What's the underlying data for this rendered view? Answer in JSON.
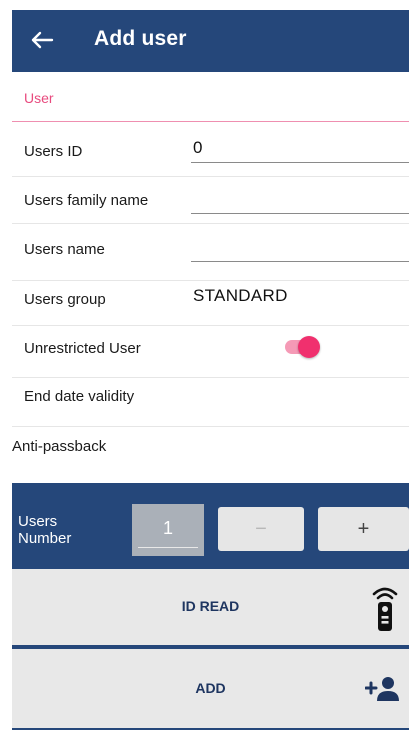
{
  "header": {
    "title": "Add user",
    "back_icon": "arrow-left-icon"
  },
  "section": {
    "label": "User"
  },
  "form": {
    "users_id": {
      "label": "Users ID",
      "value": "0"
    },
    "family_name": {
      "label": "Users family name",
      "value": ""
    },
    "name": {
      "label": "Users name",
      "value": ""
    },
    "group": {
      "label": "Users group",
      "value": "STANDARD"
    },
    "unrestricted": {
      "label": "Unrestricted User",
      "enabled": true
    },
    "end_date": {
      "label": "End date validity"
    },
    "anti_passback": {
      "label": "Anti-passback"
    }
  },
  "bottom": {
    "users_number_label": "Users Number",
    "users_number_value": "1",
    "minus_label": "−",
    "plus_label": "+",
    "id_read_label": "ID READ",
    "add_label": "ADD"
  },
  "colors": {
    "header": "#25477a",
    "accent_pink": "#f0306e",
    "section_label": "#e84a7e",
    "button_text": "#1e3560"
  }
}
